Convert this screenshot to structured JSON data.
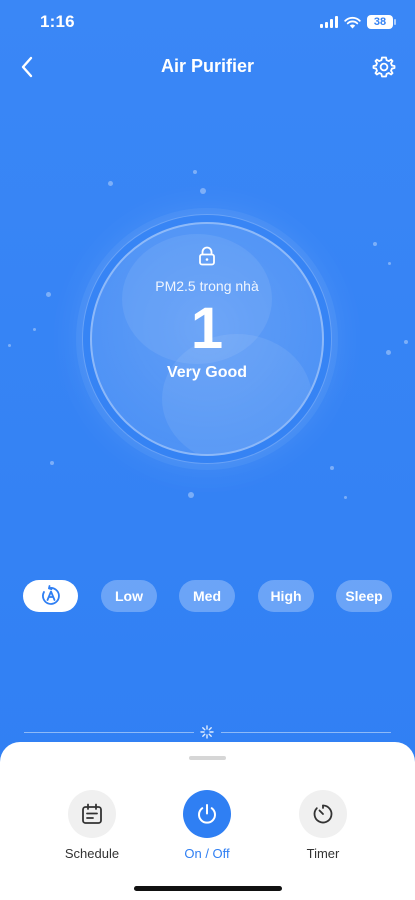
{
  "status_bar": {
    "time": "1:16",
    "battery": "38"
  },
  "header": {
    "title": "Air Purifier",
    "back_icon": "chevron-left-icon",
    "settings_icon": "gear-icon"
  },
  "air_quality": {
    "label": "PM2.5 trong nhà",
    "value": "1",
    "quality": "Very Good",
    "lock_icon": "lock-icon"
  },
  "modes": [
    {
      "label": "",
      "icon": "auto-mode-icon",
      "active": true
    },
    {
      "label": "Low",
      "active": false
    },
    {
      "label": "Med",
      "active": false
    },
    {
      "label": "High",
      "active": false
    },
    {
      "label": "Sleep",
      "active": false
    }
  ],
  "actions": {
    "schedule": {
      "label": "Schedule",
      "icon": "calendar-icon"
    },
    "power": {
      "label": "On / Off",
      "icon": "power-icon"
    },
    "timer": {
      "label": "Timer",
      "icon": "timer-icon"
    }
  },
  "colors": {
    "background": "#3385f5",
    "accent": "#2f7ff3",
    "sheet": "#ffffff"
  }
}
